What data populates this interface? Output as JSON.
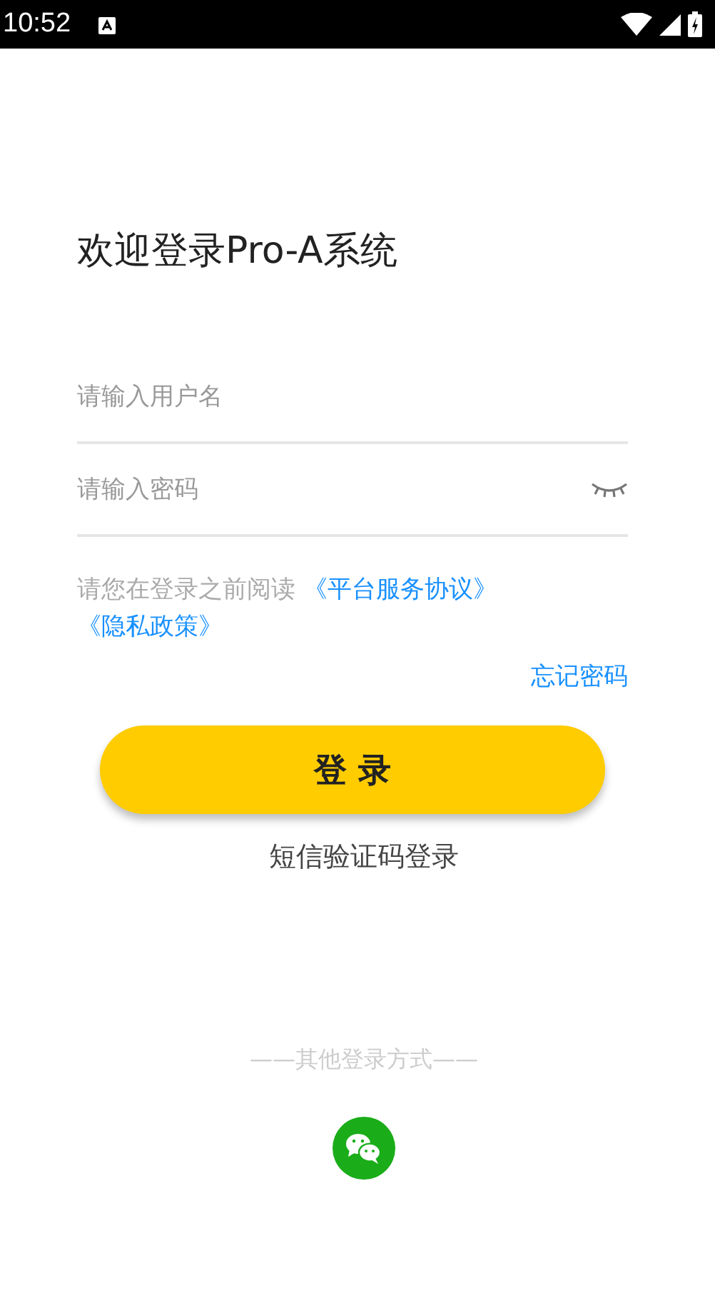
{
  "status_bar": {
    "time": "10:52"
  },
  "title": "欢迎登录Pro-A系统",
  "username_field": {
    "placeholder": "请输入用户名"
  },
  "password_field": {
    "placeholder": "请输入密码",
    "visible": false
  },
  "agreement": {
    "text": "请您在登录之前阅读",
    "links": [
      "《平台服务协议》",
      "《隐私政策》"
    ]
  },
  "forgot_password": "忘记密码",
  "login_button": "登 录",
  "sms_login": "短信验证码登录",
  "other_login": {
    "label": "——其他登录方式——",
    "methods": [
      {
        "kind": "wechat"
      }
    ]
  }
}
